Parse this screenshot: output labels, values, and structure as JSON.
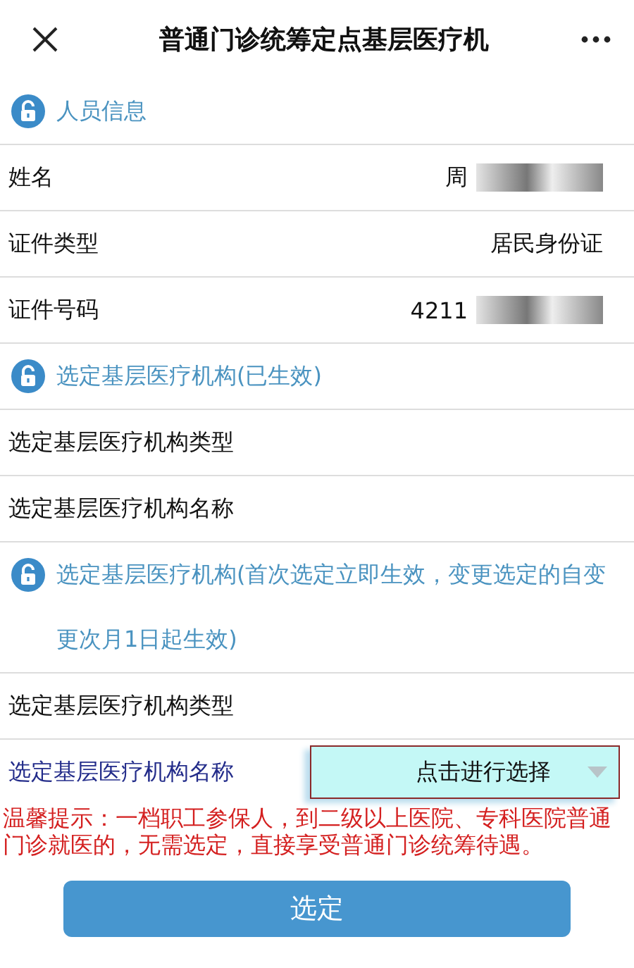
{
  "title": "普通门诊统筹定点基层医疗机",
  "sections": [
    {
      "title": "人员信息",
      "rows": [
        {
          "kind": "text",
          "label": "姓名",
          "value": "周",
          "redacted": true
        },
        {
          "kind": "text",
          "label": "证件类型",
          "value": "居民身份证"
        },
        {
          "kind": "text",
          "label": "证件号码",
          "value": "4211",
          "redacted": true
        }
      ]
    },
    {
      "title": "选定基层医疗机构(已生效)",
      "rows": [
        {
          "kind": "text",
          "label": "选定基层医疗机构类型"
        },
        {
          "kind": "text",
          "label": "选定基层医疗机构名称"
        }
      ]
    },
    {
      "title": "选定基层医疗机构(首次选定立即生效，变更选定的自变更次月1日起生效)",
      "rows": [
        {
          "kind": "text",
          "label": "选定基层医疗机构类型"
        },
        {
          "kind": "select",
          "label": "选定基层医疗机构名称",
          "placeholder": "点击进行选择"
        }
      ]
    }
  ],
  "notice": "温馨提示：一档职工参保人，到二级以上医院、专科医院普通门诊就医的，无需选定，直接享受普通门诊统筹待遇。",
  "submit": "选定"
}
